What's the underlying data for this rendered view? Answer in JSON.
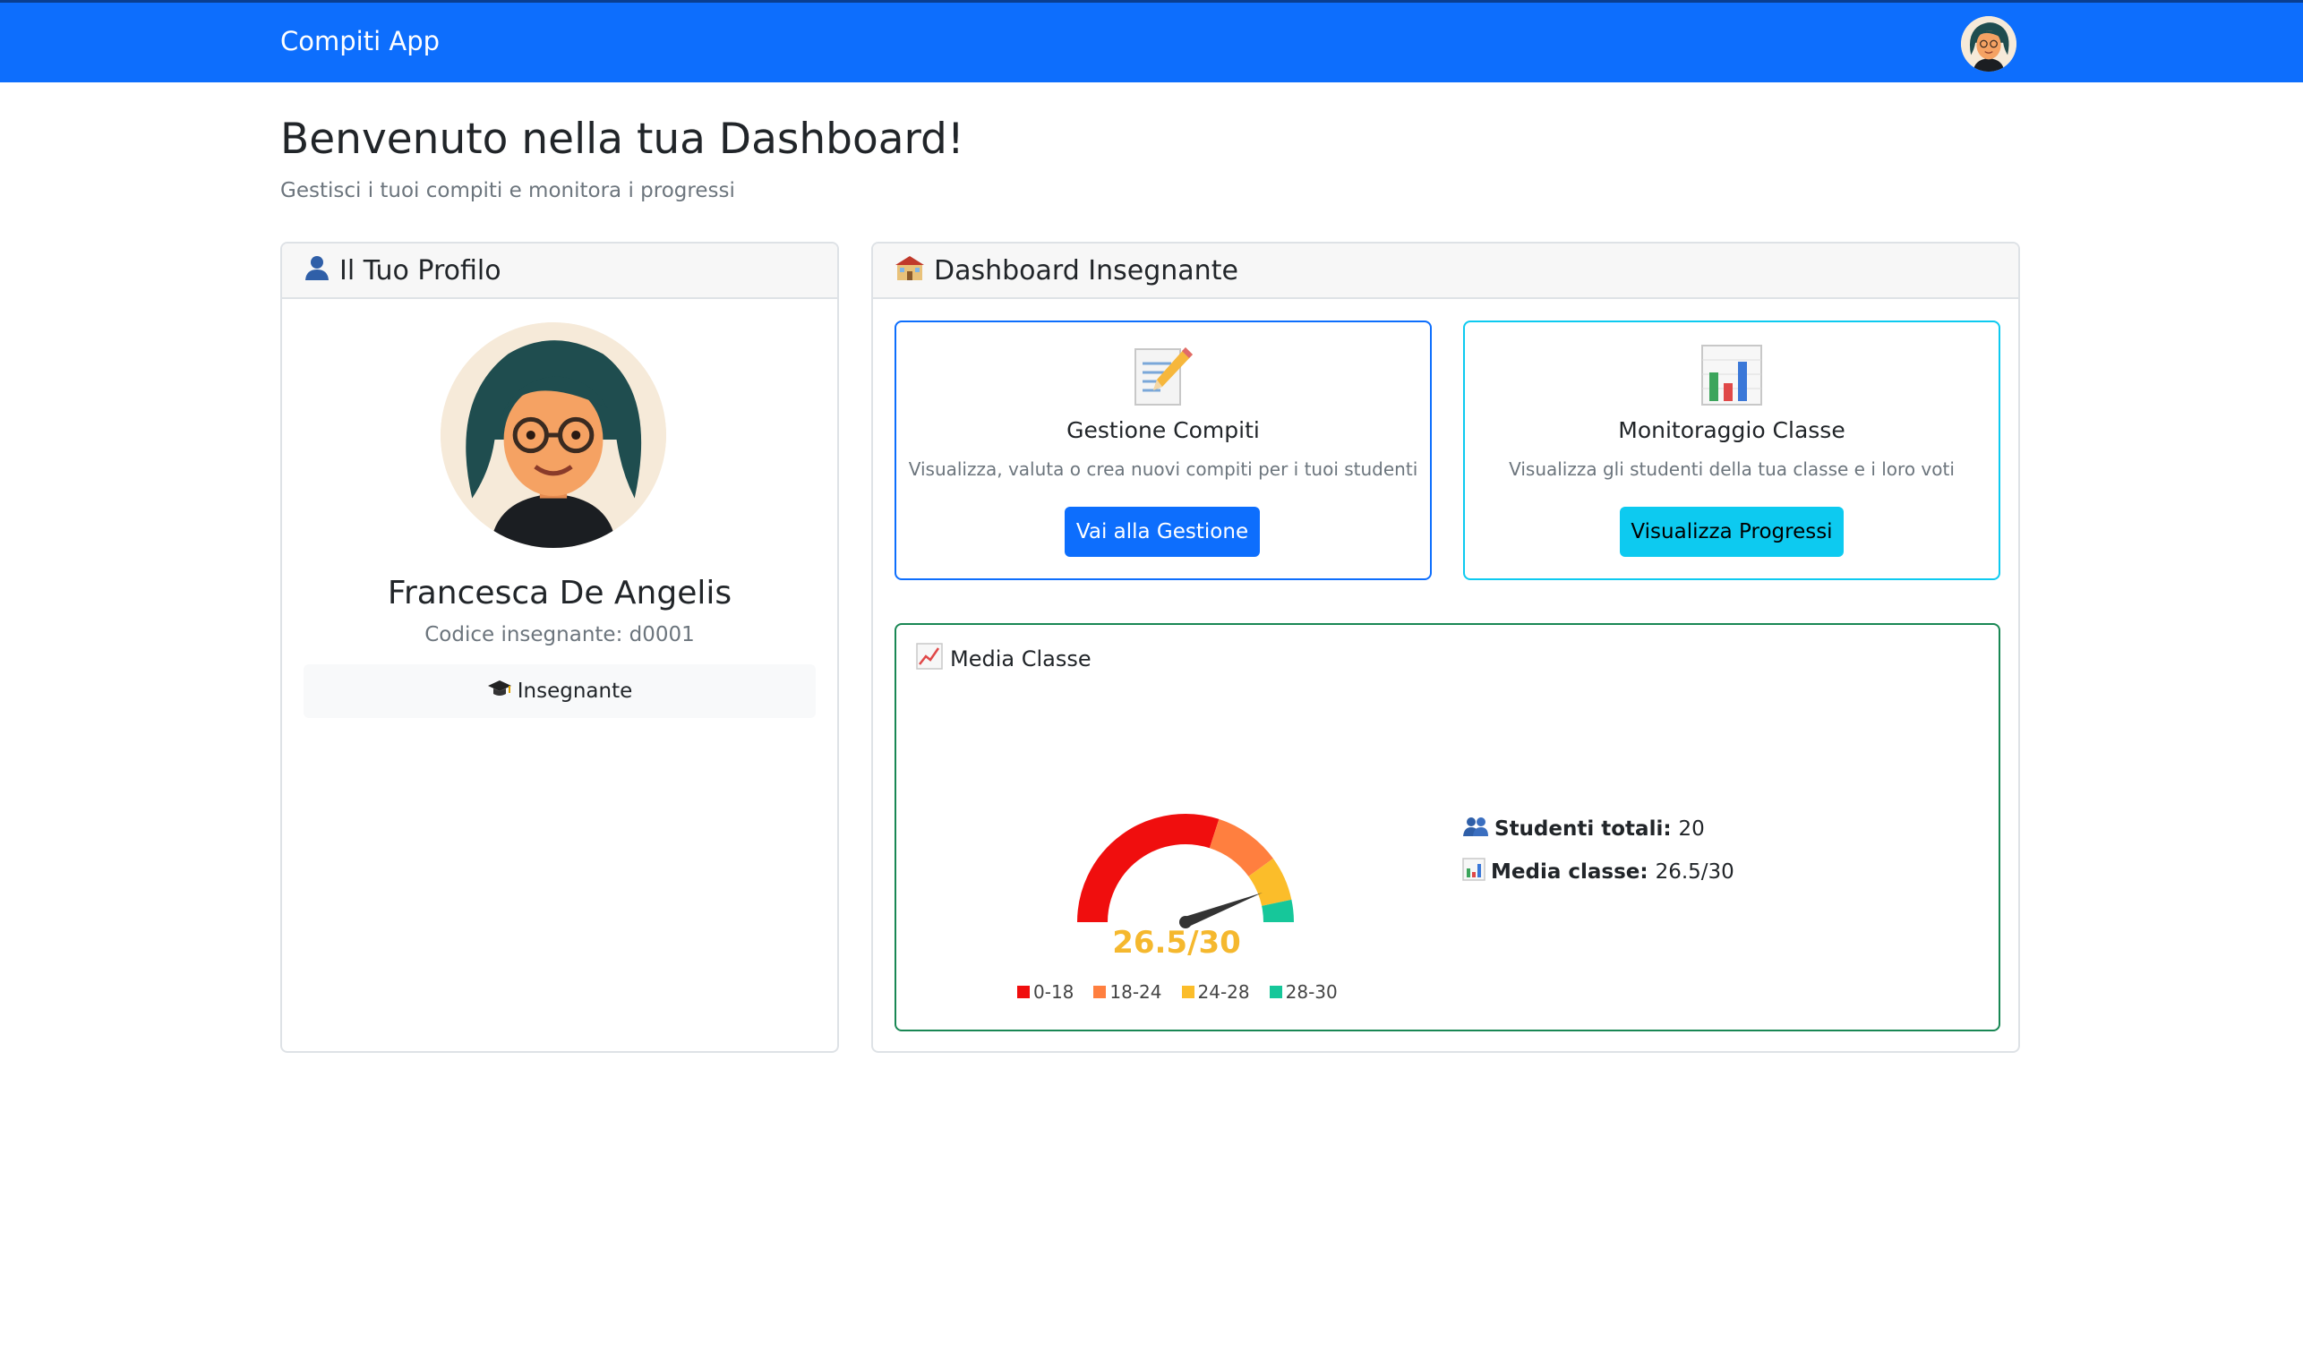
{
  "navbar": {
    "brand": "Compiti App",
    "avatar_icon": "teacher-avatar"
  },
  "header": {
    "title": "Benvenuto nella tua Dashboard!",
    "subtitle": "Gestisci i tuoi compiti e monitora i progressi"
  },
  "profile": {
    "header_icon": "user-icon",
    "header": "Il Tuo Profilo",
    "name": "Francesca De Angelis",
    "code": "Codice insegnante: d0001",
    "role_icon": "graduation-cap-icon",
    "role": "Insegnante"
  },
  "dashboard": {
    "header_icon": "school-icon",
    "header": "Dashboard Insegnante",
    "cards": [
      {
        "icon": "memo-pencil-icon",
        "title": "Gestione Compiti",
        "description": "Visualizza, valuta o crea nuovi compiti per i tuoi studenti",
        "button": "Vai alla Gestione"
      },
      {
        "icon": "bar-chart-icon",
        "title": "Monitoraggio Classe",
        "description": "Visualizza gli studenti della tua classe e i loro voti",
        "button": "Visualizza Progressi"
      }
    ],
    "media": {
      "title_icon": "trend-chart-icon",
      "title": "Media Classe",
      "gauge": {
        "value": 26.5,
        "max": 30,
        "min": 0,
        "display": "26.5/30"
      },
      "legend": [
        {
          "label": "0-18",
          "color": "#f00e0e"
        },
        {
          "label": "18-24",
          "color": "#ff7f3f"
        },
        {
          "label": "24-28",
          "color": "#fbbd2a"
        },
        {
          "label": "28-30",
          "color": "#16c79a"
        }
      ],
      "stats": [
        {
          "icon": "people-icon",
          "label": "Studenti totali:",
          "value": "20"
        },
        {
          "icon": "bar-chart-icon",
          "label": "Media classe:",
          "value": "26.5/30"
        }
      ]
    }
  }
}
